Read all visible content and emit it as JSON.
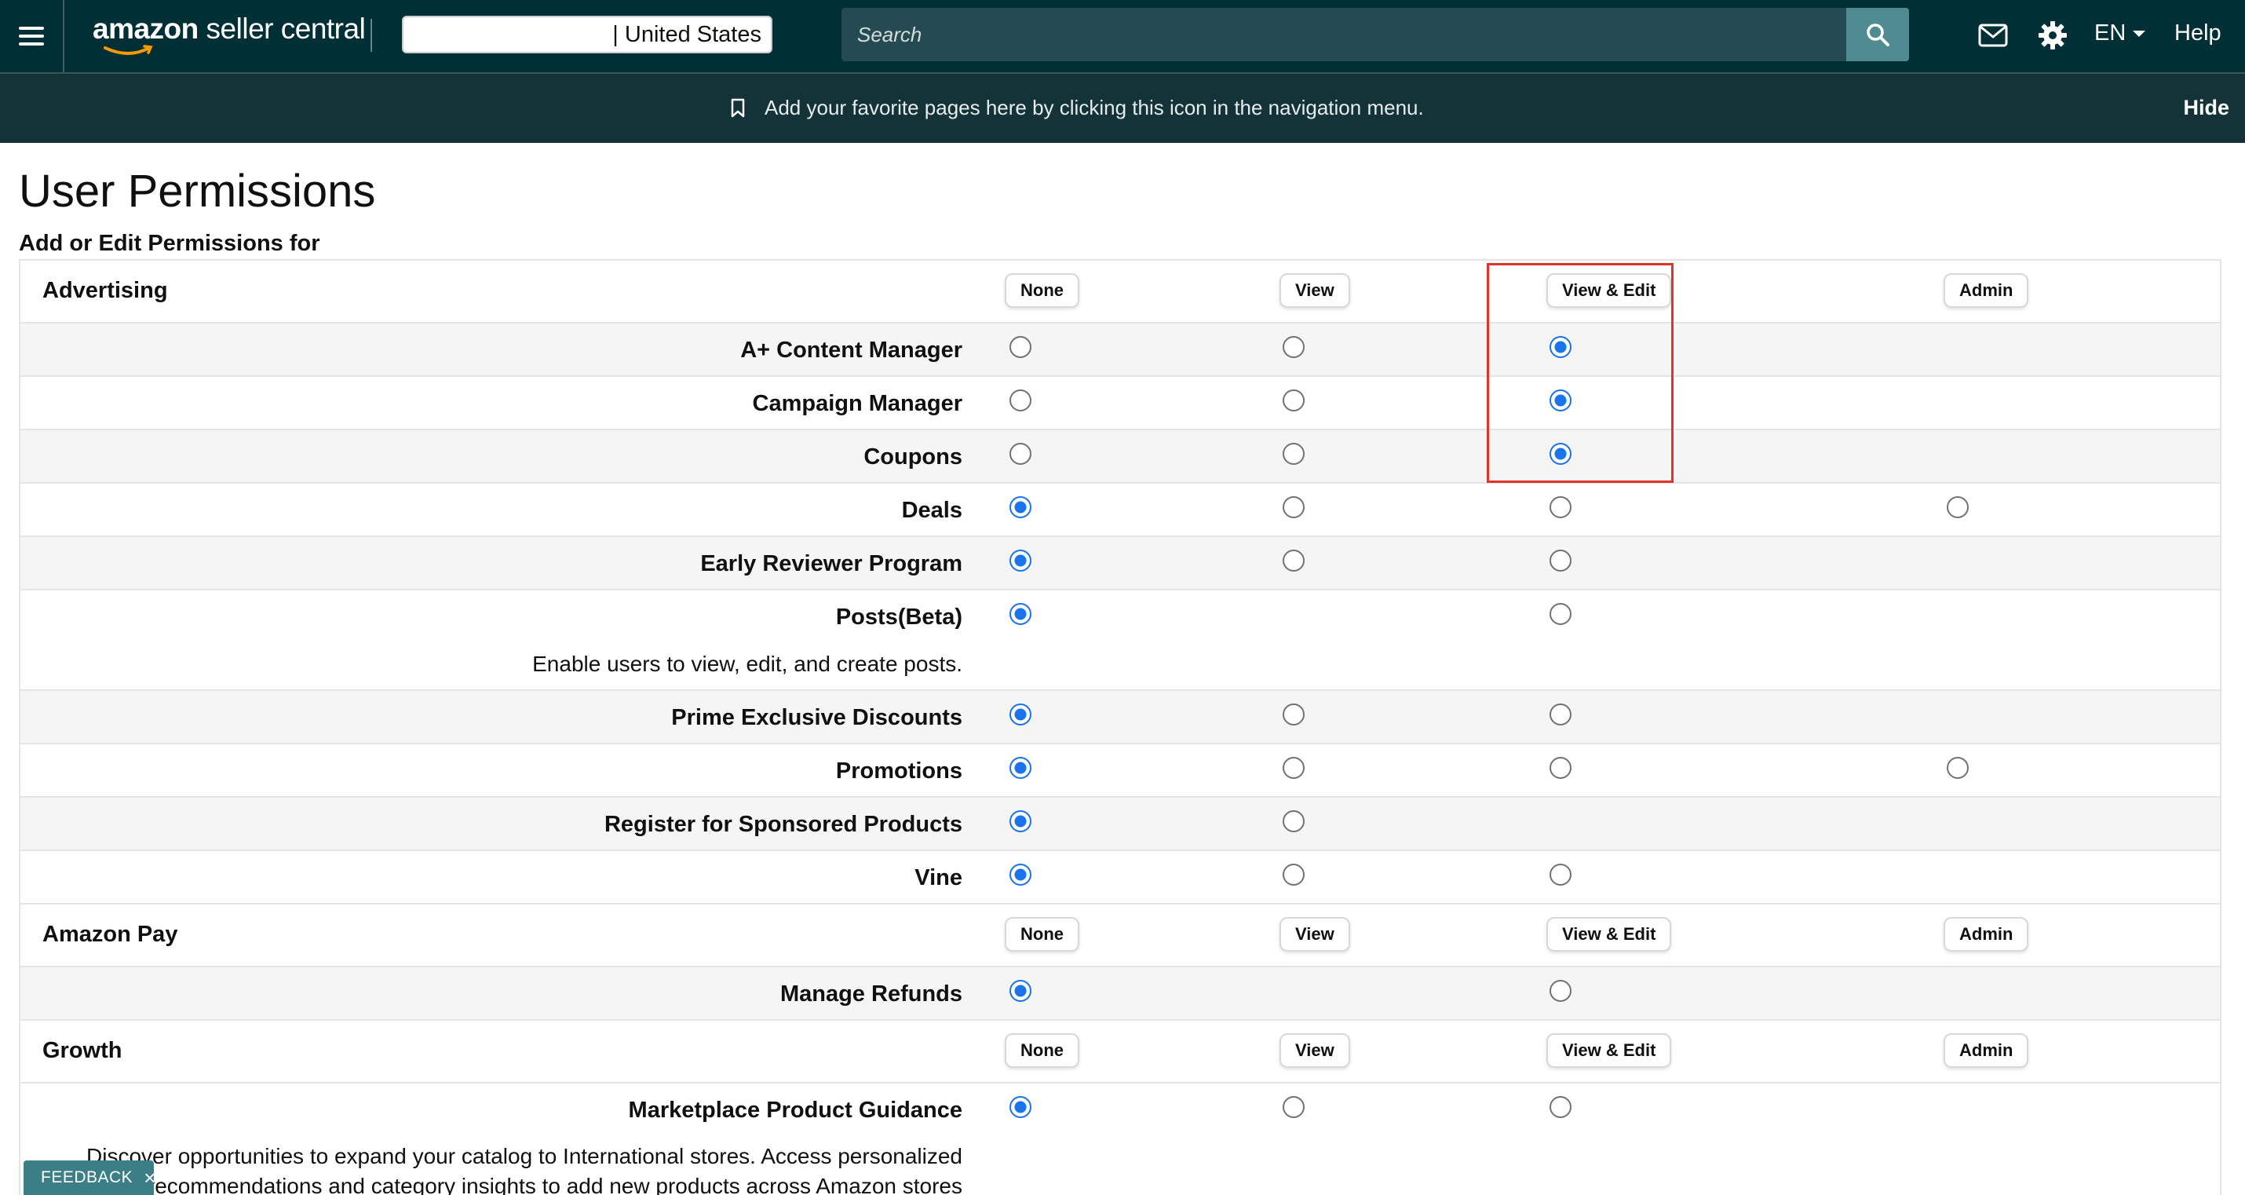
{
  "header": {
    "logo_text_bold": "amazon",
    "logo_text_rest": " seller central",
    "store_selector": "| United States",
    "search_placeholder": "Search",
    "language": "EN",
    "help_label": "Help"
  },
  "favorites_bar": {
    "message": "Add your favorite pages here by clicking this icon in the navigation menu.",
    "hide_label": "Hide"
  },
  "page": {
    "title": "User Permissions",
    "subtitle": "Add or Edit Permissions for"
  },
  "columns": {
    "none": "None",
    "view": "View",
    "view_edit": "View & Edit",
    "admin": "Admin"
  },
  "sections": [
    {
      "name": "Advertising",
      "permissions": [
        {
          "name": "A+ Content Manager",
          "selected": "view_edit",
          "options": [
            "none",
            "view",
            "view_edit"
          ]
        },
        {
          "name": "Campaign Manager",
          "selected": "view_edit",
          "options": [
            "none",
            "view",
            "view_edit"
          ]
        },
        {
          "name": "Coupons",
          "selected": "view_edit",
          "options": [
            "none",
            "view",
            "view_edit"
          ]
        },
        {
          "name": "Deals",
          "selected": "none",
          "options": [
            "none",
            "view",
            "view_edit",
            "admin"
          ]
        },
        {
          "name": "Early Reviewer Program",
          "selected": "none",
          "options": [
            "none",
            "view",
            "view_edit"
          ]
        },
        {
          "name": "Posts(Beta)",
          "description": "Enable users to view, edit, and create posts.",
          "selected": "none",
          "options": [
            "none",
            "view_edit"
          ]
        },
        {
          "name": "Prime Exclusive Discounts",
          "selected": "none",
          "options": [
            "none",
            "view",
            "view_edit"
          ]
        },
        {
          "name": "Promotions",
          "selected": "none",
          "options": [
            "none",
            "view",
            "view_edit",
            "admin"
          ]
        },
        {
          "name": "Register for Sponsored Products",
          "selected": "none",
          "options": [
            "none",
            "view"
          ]
        },
        {
          "name": "Vine",
          "selected": "none",
          "options": [
            "none",
            "view",
            "view_edit"
          ]
        }
      ]
    },
    {
      "name": "Amazon Pay",
      "permissions": [
        {
          "name": "Manage Refunds",
          "selected": "none",
          "options": [
            "none",
            "view_edit"
          ]
        }
      ]
    },
    {
      "name": "Growth",
      "permissions": [
        {
          "name": "Marketplace Product Guidance",
          "description": "Discover opportunities to expand your catalog to International stores. Access personalized recommendations and category insights to add new products across Amazon stores",
          "selected": "none",
          "options": [
            "none",
            "view",
            "view_edit"
          ]
        }
      ]
    }
  ],
  "feedback_label": "FEEDBACK",
  "colors": {
    "nav_bg": "#002f36",
    "favbar_bg": "#143338",
    "radio_selected": "#1a73e8",
    "highlight": "#e0332c"
  }
}
